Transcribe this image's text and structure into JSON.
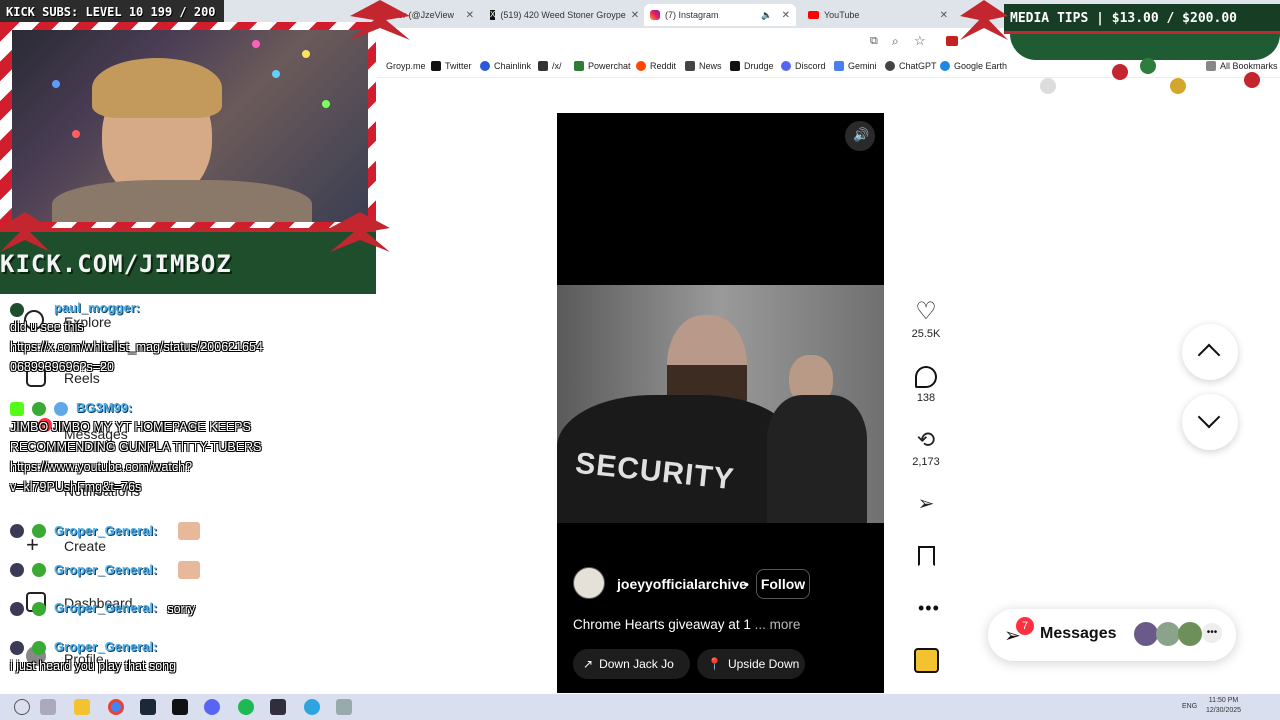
{
  "browser": {
    "tabs": [
      {
        "label": "er (@JzeView",
        "active": false
      },
      {
        "label": "(519) 420 Weed Stoner Groype",
        "active": false
      },
      {
        "label": "(7) Instagram",
        "active": true
      },
      {
        "label": "YouTube",
        "active": false
      }
    ],
    "bookmarks": [
      "Groyp.me",
      "Twitter",
      "Chainlink",
      "/x/",
      "Powerchat",
      "Reddit",
      "News",
      "Drudge",
      "Discord",
      "Gemini",
      "ChatGPT",
      "Google Earth"
    ],
    "all_bookmarks": "All Bookmarks"
  },
  "stream": {
    "kick_subs": "KICK SUBS: LEVEL 10 199 / 200",
    "kick_url": "KICK.COM/JIMBOZ",
    "media_tips": "MEDIA TIPS | $13.00 / $200.00"
  },
  "ig_nav": {
    "items": [
      "Explore",
      "Reels",
      "Messages",
      "Notifications",
      "Create",
      "Dashboard",
      "Profile"
    ],
    "messages_badge": "7"
  },
  "chat": [
    {
      "user": "paul_mogger:",
      "text": "did u see this https://x.com/whitelist_mag/status/200621654 0689939696?s=20"
    },
    {
      "user": "BG3M99:",
      "text": "JIMBO JIMBO MY YT HOMEPAGE KEEPS RECOMMENDING GUNPLA TITTY-TUBERS https://www.youtube.com/watch?v=kl79PUshFmg&t=76s"
    },
    {
      "user": "Groper_General:",
      "text": ""
    },
    {
      "user": "Groper_General:",
      "text": ""
    },
    {
      "user": "Groper_General:",
      "text": "sorry"
    },
    {
      "user": "Groper_General:",
      "text": "i just heard you play that song"
    }
  ],
  "reel": {
    "username": "joeyyofficialarchive",
    "follow": "Follow",
    "caption": "Chrome Hearts giveaway at 1",
    "more": "... more",
    "audio": "Down  Jack Jo",
    "location": "Upside Down",
    "shirt_text": "SECURITY",
    "likes": "25.5K",
    "comments": "138",
    "reposts": "2,173"
  },
  "messages_widget": {
    "label": "Messages",
    "badge": "7"
  },
  "taskbar": {
    "lang": "ENG",
    "time": "11:50 PM",
    "date": "12/30/2025"
  },
  "colors": {
    "accent_red": "#ff3040",
    "chat_user": "#4fb0e6",
    "kick_green": "#1f4e2d"
  }
}
